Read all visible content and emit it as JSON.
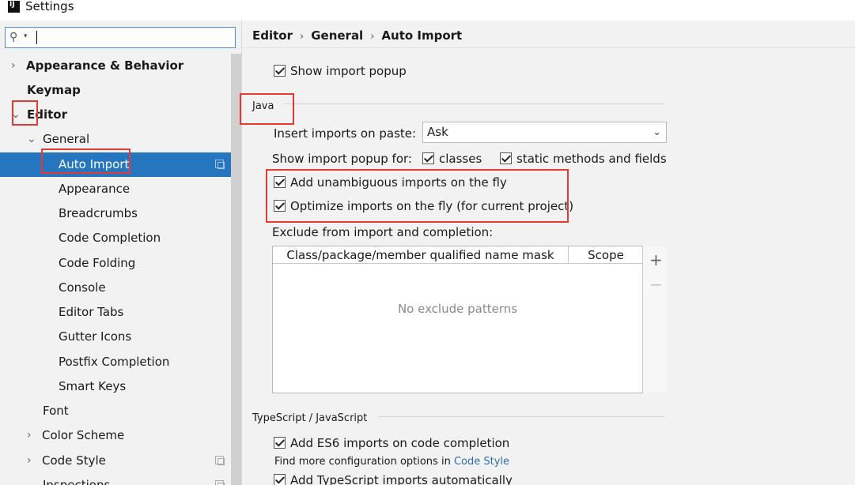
{
  "window": {
    "title": "Settings",
    "app_icon": "intellij-idea-icon"
  },
  "search": {
    "value": "",
    "placeholder": ""
  },
  "sidebar": {
    "items": [
      {
        "label": "Appearance & Behavior",
        "bold": true,
        "arrow": "›"
      },
      {
        "label": "Keymap",
        "bold": true
      },
      {
        "label": "Editor",
        "bold": true,
        "arrow": "⌄"
      },
      {
        "label": "General",
        "arrow": "⌄"
      },
      {
        "label": "Auto Import",
        "selected": true
      },
      {
        "label": "Appearance"
      },
      {
        "label": "Breadcrumbs"
      },
      {
        "label": "Code Completion"
      },
      {
        "label": "Code Folding"
      },
      {
        "label": "Console"
      },
      {
        "label": "Editor Tabs"
      },
      {
        "label": "Gutter Icons"
      },
      {
        "label": "Postfix Completion"
      },
      {
        "label": "Smart Keys"
      },
      {
        "label": "Font"
      },
      {
        "label": "Color Scheme",
        "arrow": "›"
      },
      {
        "label": "Code Style",
        "arrow": "›"
      },
      {
        "label": "Inspections"
      }
    ]
  },
  "breadcrumb": {
    "part1": "Editor",
    "part2": "General",
    "part3": "Auto Import",
    "separator": "›"
  },
  "general": {
    "show_import_popup": "Show import popup",
    "show_import_popup_checked": true
  },
  "java": {
    "section_title": "Java",
    "insert_imports_label": "Insert imports on paste:",
    "insert_imports_value": "Ask",
    "show_popup_for_label": "Show import popup for:",
    "classes_label": "classes",
    "classes_checked": true,
    "static_label": "static methods and fields",
    "static_checked": true,
    "add_unambiguous": "Add unambiguous imports on the fly",
    "add_unambiguous_checked": true,
    "optimize": "Optimize imports on the fly (for current project)",
    "optimize_checked": true,
    "exclude_label": "Exclude from import and completion:",
    "table": {
      "columns": [
        "Class/package/member qualified name mask",
        "Scope"
      ],
      "empty_text": "No exclude patterns",
      "add_icon": "+",
      "remove_icon": "−"
    }
  },
  "typescript": {
    "section_title": "TypeScript / JavaScript",
    "es6": "Add ES6 imports on code completion",
    "es6_checked": true,
    "find_more_prefix": "Find more configuration options in",
    "find_more_link": "Code Style",
    "ts_auto": "Add TypeScript imports automatically",
    "ts_auto_checked": true
  },
  "colors": {
    "selection": "#2675bf",
    "highlight": "#e53935",
    "link": "#2f6fb5"
  }
}
